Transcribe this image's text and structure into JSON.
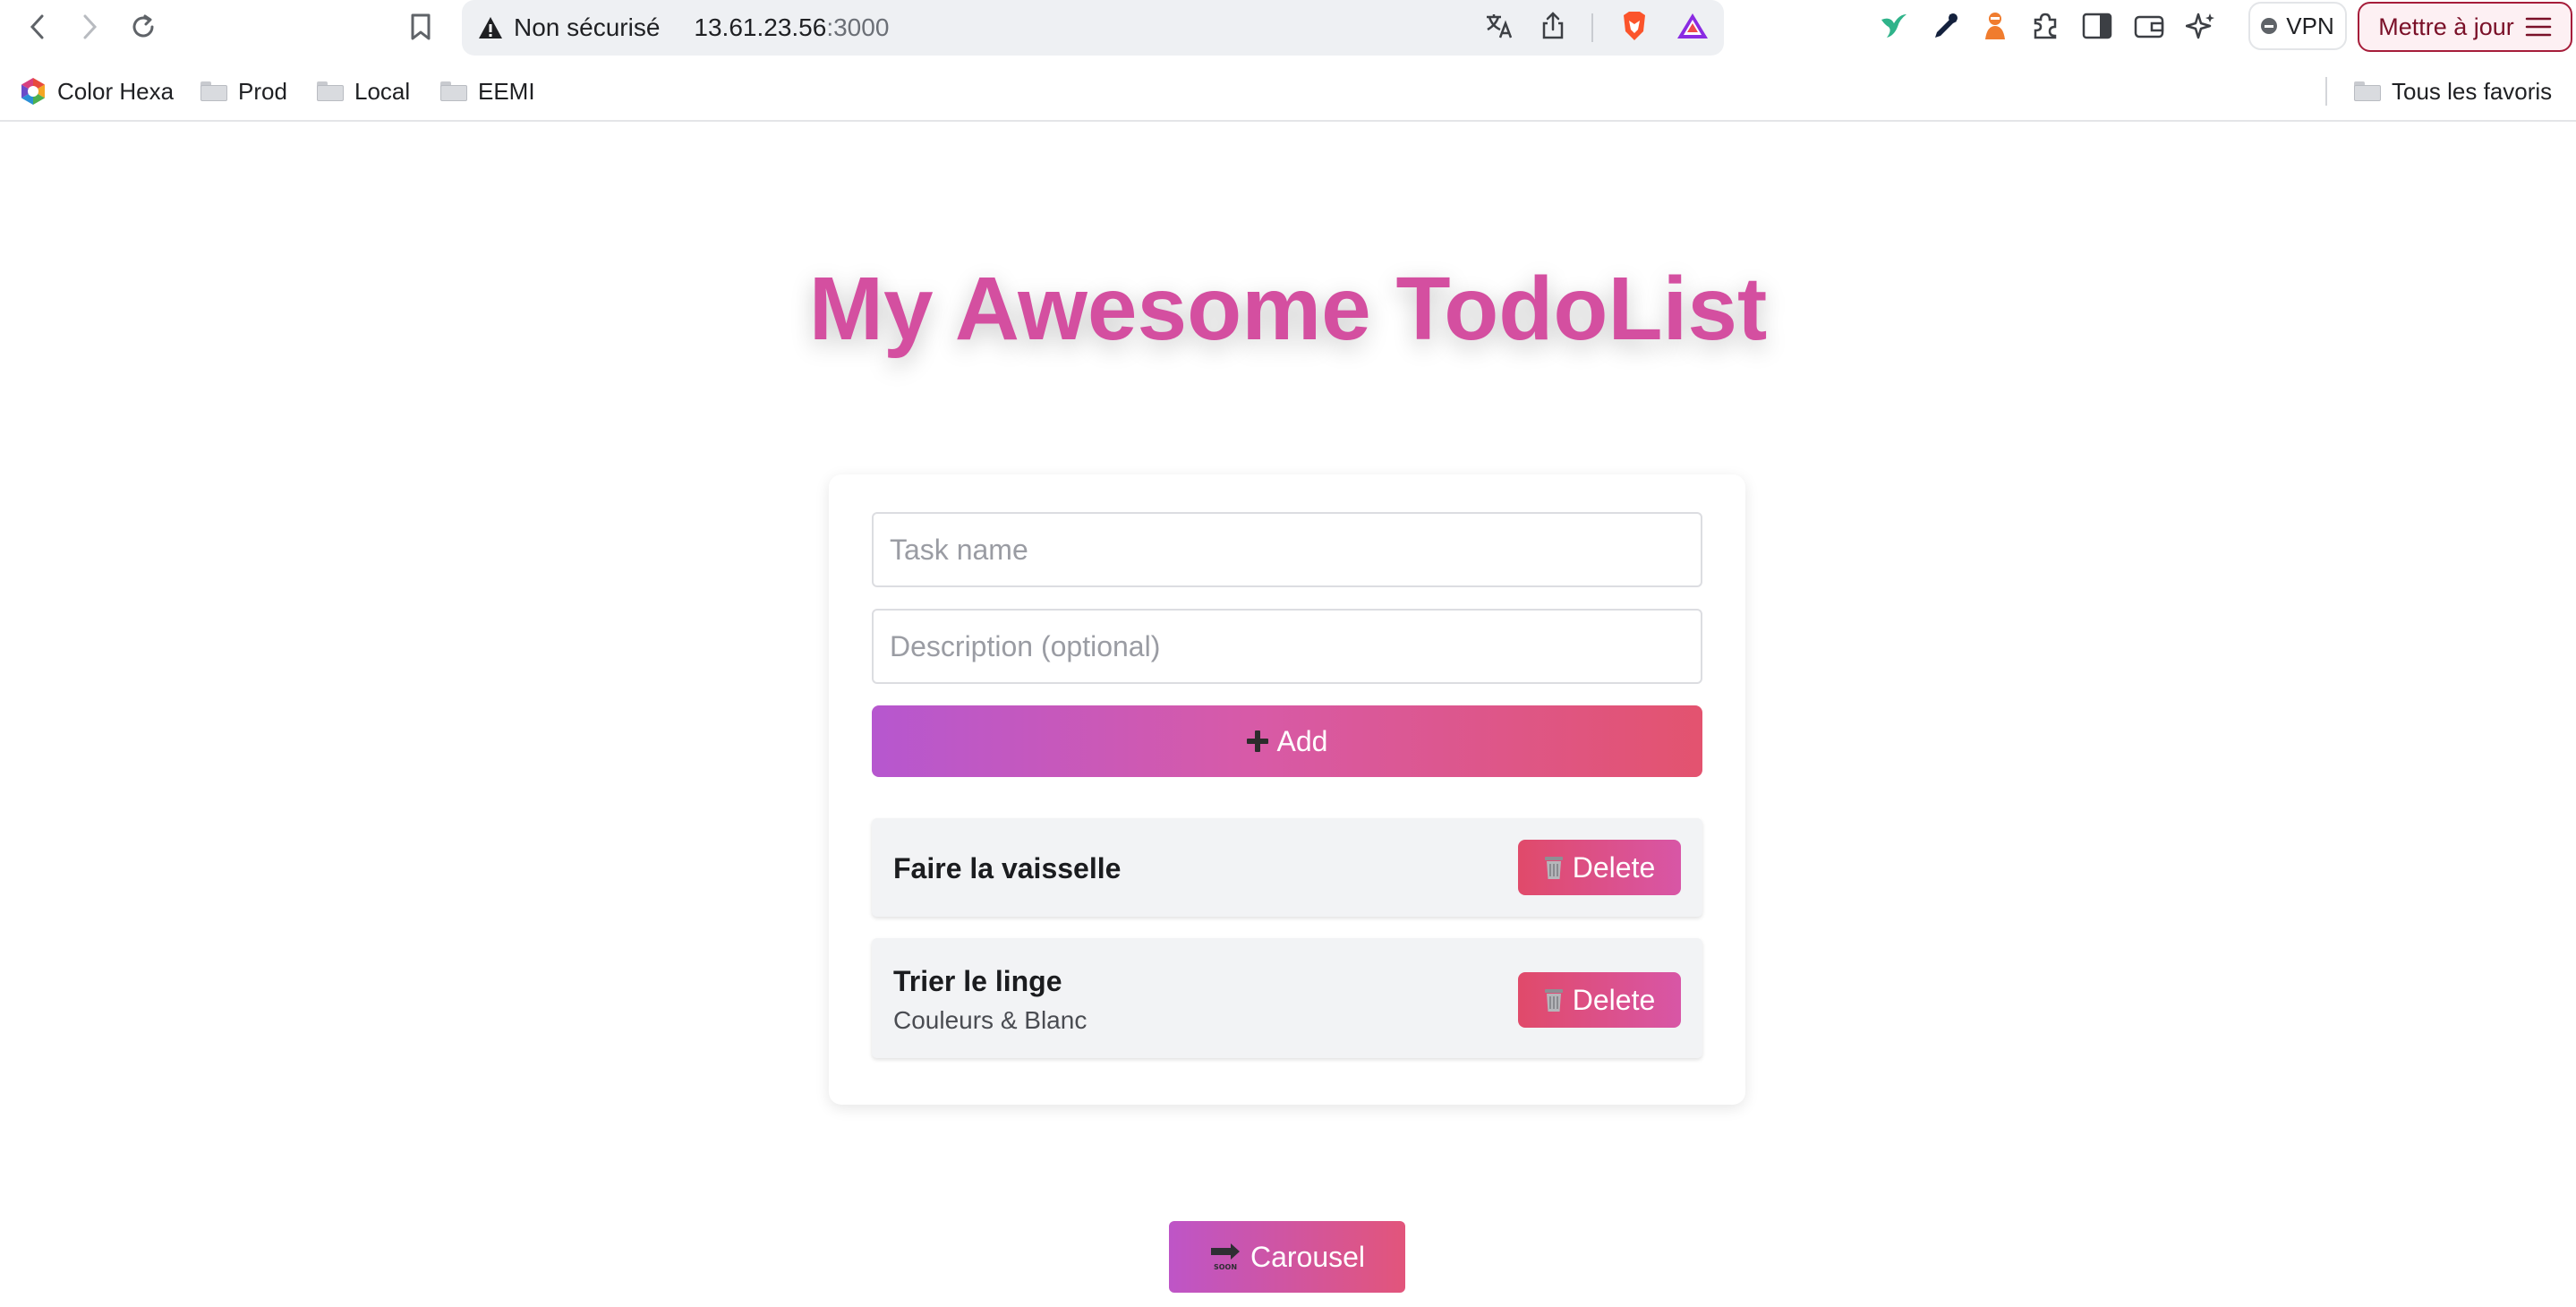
{
  "browser": {
    "security_label": "Non sécurisé",
    "url_host": "13.61.23.56",
    "url_port": ":3000",
    "vpn_label": "VPN",
    "update_label": "Mettre à jour"
  },
  "bookmarks": {
    "items": [
      "Color Hexa",
      "Prod",
      "Local",
      "EEMI"
    ],
    "all_favorites": "Tous les favoris"
  },
  "page": {
    "title": "My Awesome TodoList",
    "task_name_placeholder": "Task name",
    "description_placeholder": "Description (optional)",
    "add_label": "Add",
    "tasks": [
      {
        "name": "Faire la vaisselle",
        "description": ""
      },
      {
        "name": "Trier le linge",
        "description": "Couleurs & Blanc"
      }
    ],
    "delete_label": "Delete",
    "carousel_label": "Carousel"
  },
  "colors": {
    "title": "#d44fa0",
    "add_gradient": [
      "#b657cf",
      "#e3536f"
    ],
    "delete_gradient": [
      "#e04a6a",
      "#d856a6"
    ],
    "carousel_gradient": [
      "#be55c7",
      "#e2557b"
    ]
  }
}
